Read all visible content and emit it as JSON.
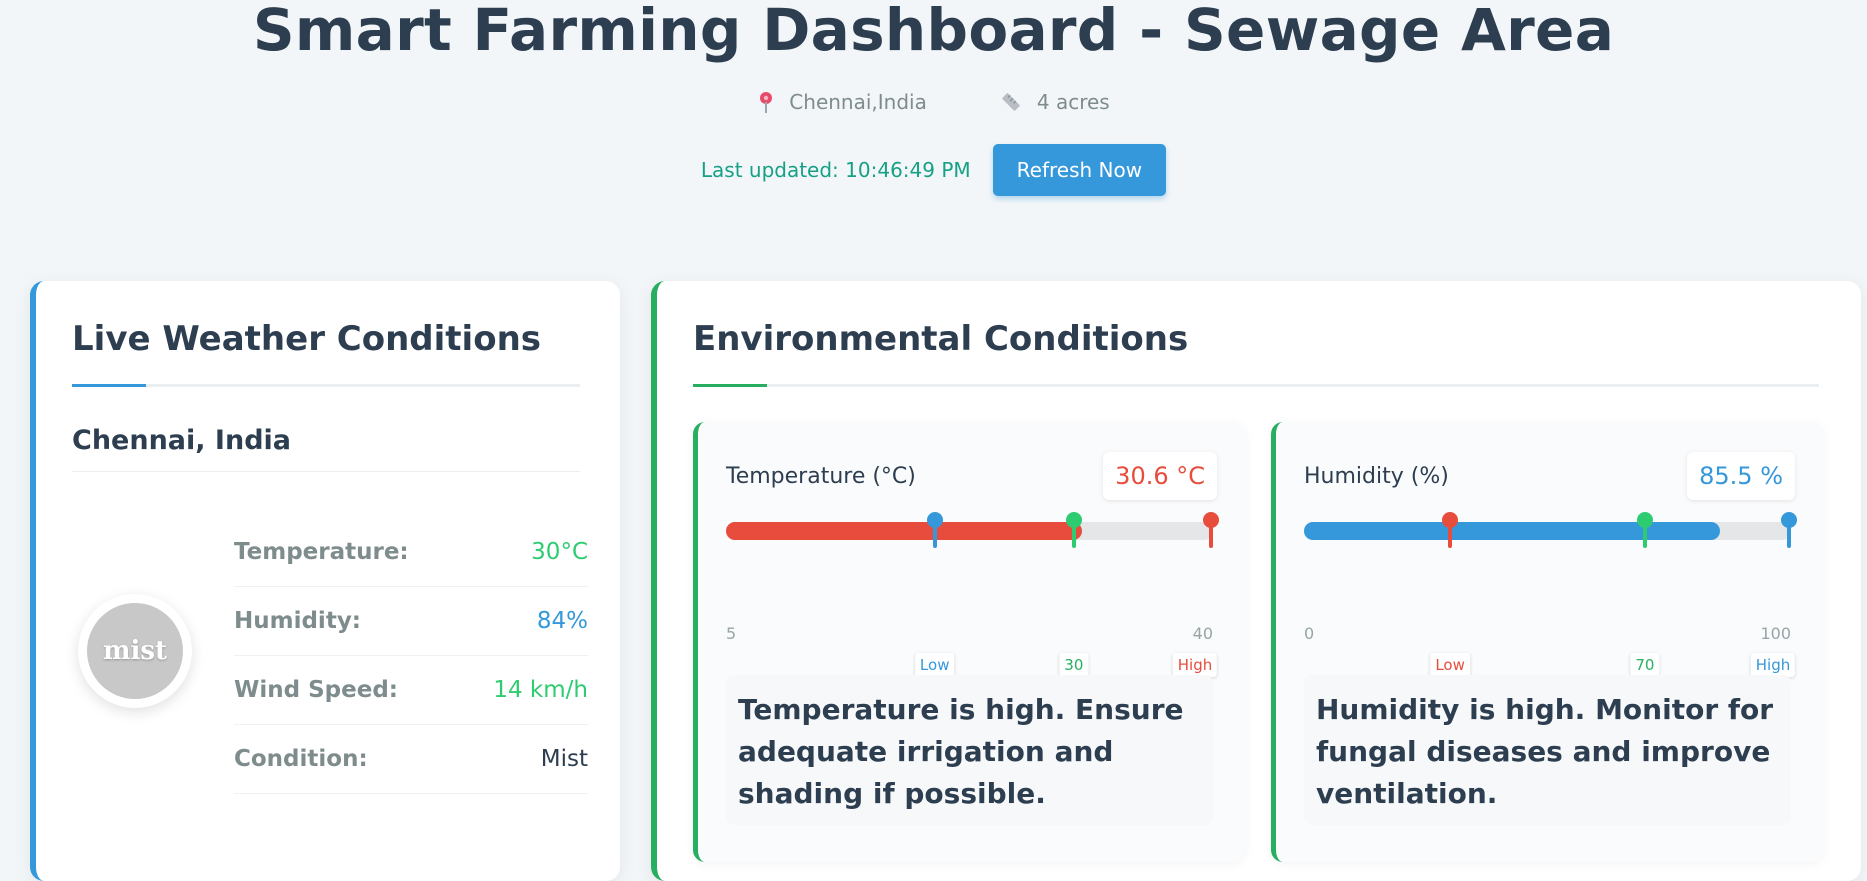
{
  "header": {
    "title": "Smart Farming Dashboard - Sewage Area",
    "location": "Chennai,India",
    "area": "4 acres",
    "last_updated": "Last updated: 10:46:49 PM",
    "refresh_label": "Refresh Now"
  },
  "icons": {
    "location": "map-pin-icon",
    "area": "ruler-icon",
    "weather": "mist-icon"
  },
  "colors": {
    "primary": "#3498db",
    "success": "#27ae60",
    "danger": "#e74c3c",
    "text": "#2c3e50"
  },
  "weather": {
    "title": "Live Weather Conditions",
    "city": "Chennai, India",
    "icon_text": "mist",
    "rows": [
      {
        "label": "Temperature:",
        "value": "30°C"
      },
      {
        "label": "Humidity:",
        "value": "84%"
      },
      {
        "label": "Wind Speed:",
        "value": "14 km/h"
      },
      {
        "label": "Condition:",
        "value": "Mist"
      }
    ]
  },
  "environment": {
    "title": "Environmental Conditions",
    "temperature": {
      "label": "Temperature (°C)",
      "value": 30.6,
      "value_text": "30.6 °C",
      "min": 5,
      "max": 40,
      "min_label": "5",
      "max_label": "40",
      "thresholds": {
        "low": 20,
        "optimal": 30,
        "high": 40
      },
      "tags": {
        "low": "Low",
        "optimal": "30",
        "high": "High"
      },
      "advice": "Temperature is high. Ensure adequate irrigation and shading if possible."
    },
    "humidity": {
      "label": "Humidity (%)",
      "value": 85.5,
      "value_text": "85.5 %",
      "min": 0,
      "max": 100,
      "min_label": "0",
      "max_label": "100",
      "thresholds": {
        "low": 30,
        "optimal": 70,
        "high": 100
      },
      "tags": {
        "low": "Low",
        "optimal": "70",
        "high": "High"
      },
      "advice": "Humidity is high. Monitor for fungal diseases and improve ventilation."
    }
  }
}
